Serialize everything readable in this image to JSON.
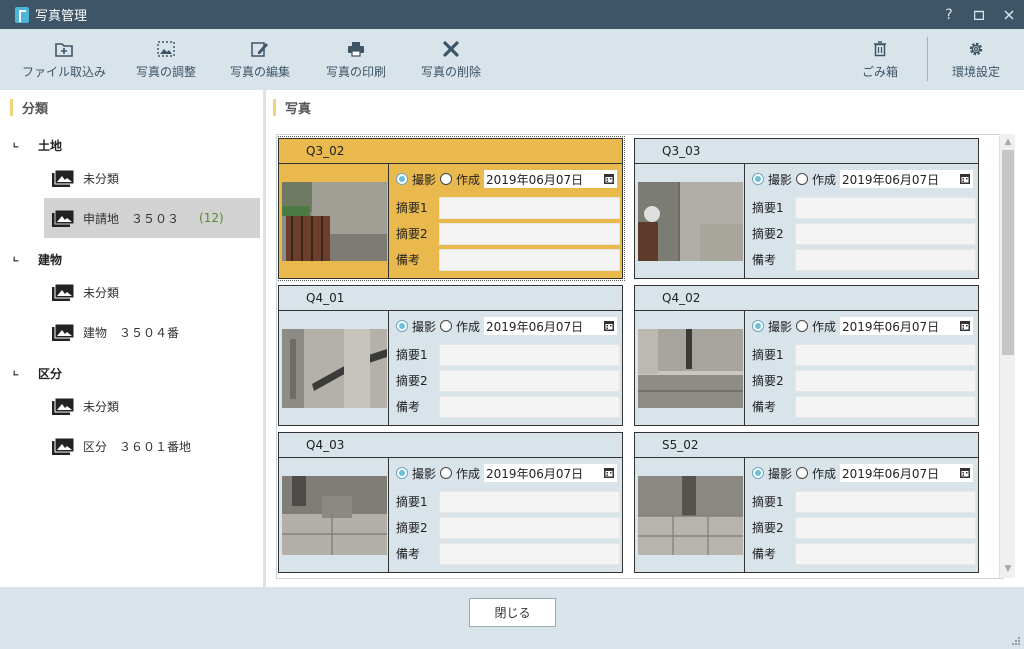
{
  "window": {
    "title": "写真管理"
  },
  "toolbar": {
    "import": "ファイル取込み",
    "adjust": "写真の調整",
    "edit": "写真の編集",
    "print": "写真の印刷",
    "delete": "写真の削除",
    "trash": "ごみ箱",
    "settings": "環境設定"
  },
  "left": {
    "header": "分類",
    "categories": [
      {
        "label": "土地",
        "items": [
          {
            "label": "未分類"
          },
          {
            "label": "申請地　３５０３",
            "count": "(12)"
          }
        ]
      },
      {
        "label": "建物",
        "items": [
          {
            "label": "未分類"
          },
          {
            "label": "建物　３５０４番"
          }
        ]
      },
      {
        "label": "区分",
        "items": [
          {
            "label": "未分類"
          },
          {
            "label": "区分　３６０１番地"
          }
        ]
      }
    ]
  },
  "right": {
    "header": "写真"
  },
  "form_labels": {
    "shoot": "撮影",
    "create": "作成",
    "summary1": "摘要1",
    "summary2": "摘要2",
    "note": "備考"
  },
  "photos": [
    {
      "name": "Q3_02",
      "date": "2019年06月07日",
      "selected": true
    },
    {
      "name": "Q3_03",
      "date": "2019年06月07日"
    },
    {
      "name": "Q4_01",
      "date": "2019年06月07日"
    },
    {
      "name": "Q4_02",
      "date": "2019年06月07日"
    },
    {
      "name": "Q4_03",
      "date": "2019年06月07日"
    },
    {
      "name": "S5_02",
      "date": "2019年06月07日"
    }
  ],
  "footer": {
    "close": "閉じる"
  }
}
